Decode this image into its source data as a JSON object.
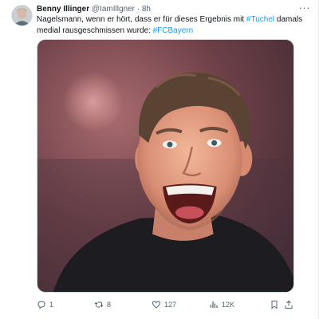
{
  "post": {
    "author": {
      "name": "Benny Illinger",
      "handle": "@IamIllgner",
      "separator": "·",
      "time": "8h"
    },
    "more_glyph": "···",
    "text": {
      "part1": "Nagelsmann, wenn er hört, dass er für dieses Ergebnis mit ",
      "hashtag1": "#Tuchel",
      "part2": " damals medial rausgeschmissen wurde: ",
      "hashtag2": "#FCBayern"
    },
    "actions": {
      "replies": "1",
      "reposts": "8",
      "likes": "127",
      "views": "12K"
    }
  },
  "colors": {
    "link": "#1d9bf0",
    "secondary_text": "#536471",
    "primary_text": "#0f1419"
  },
  "icons": [
    "more-icon",
    "reply-icon",
    "repost-icon",
    "like-icon",
    "views-icon",
    "bookmark-icon",
    "share-icon"
  ]
}
